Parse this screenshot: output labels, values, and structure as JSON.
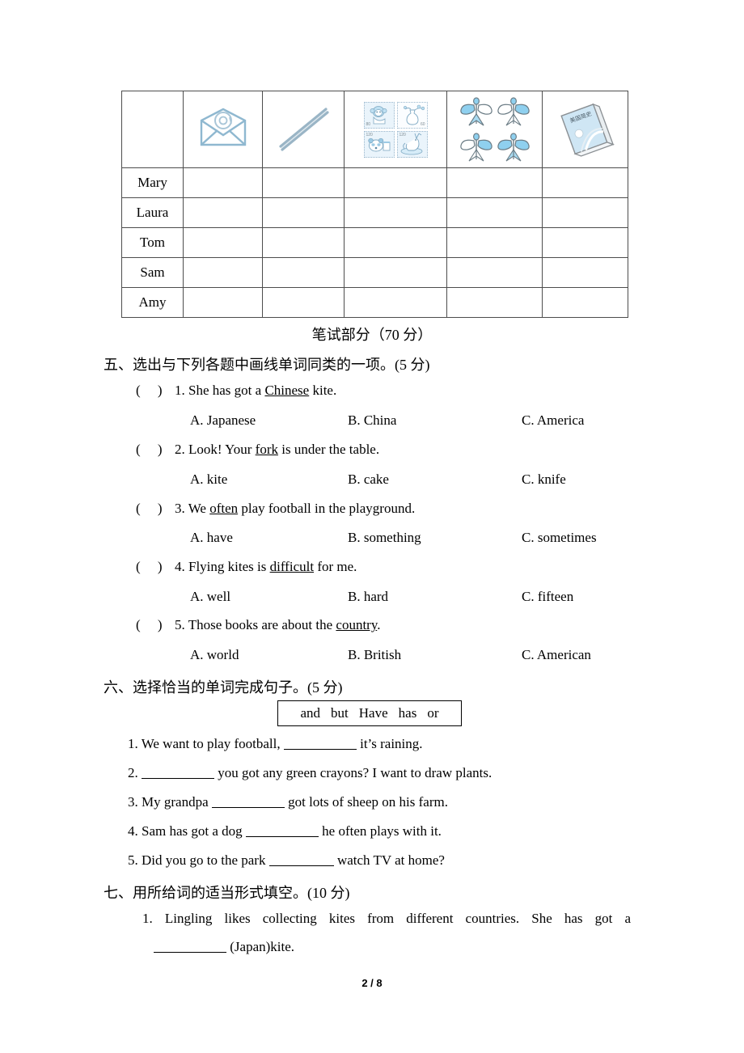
{
  "page": {
    "footer": "2 / 8",
    "written_part_heading": "笔试部分（70 分）"
  },
  "survey_table": {
    "columns": [
      {
        "icon": "email-envelope-icon",
        "label": "email"
      },
      {
        "icon": "chopsticks-icon",
        "label": "chopsticks"
      },
      {
        "icon": "stamps-icon",
        "label": "stamps"
      },
      {
        "icon": "swallow-kites-icon",
        "label": "kites"
      },
      {
        "icon": "book-icon",
        "label": "book",
        "book_title": "美国简史"
      }
    ],
    "stamps": [
      {
        "value": "80",
        "pos": "bl",
        "animal": "monkey"
      },
      {
        "value": "60",
        "pos": "br",
        "animal": "vase-flowers"
      },
      {
        "value": "120",
        "pos": "tl",
        "animal": "panda"
      },
      {
        "value": "120",
        "pos": "tl",
        "animal": "deer"
      }
    ],
    "rows": [
      {
        "name": "Mary"
      },
      {
        "name": "Laura"
      },
      {
        "name": "Tom"
      },
      {
        "name": "Sam"
      },
      {
        "name": "Amy"
      }
    ]
  },
  "section_five": {
    "heading": "五、选出与下列各题中画线单词同类的一项。(5 分)",
    "questions": [
      {
        "marker": "(",
        "close": ")",
        "number": "1.",
        "pre": " She has got a ",
        "underlined": "Chinese",
        "post": " kite.",
        "options": {
          "a": "A. Japanese",
          "b": "B. China",
          "c": "C. America"
        }
      },
      {
        "marker": "(",
        "close": ")",
        "number": "2.",
        "pre": " Look! Your ",
        "underlined": "fork",
        "post": " is under the table.",
        "options": {
          "a": "A. kite",
          "b": "B. cake",
          "c": "C. knife"
        }
      },
      {
        "marker": "(",
        "close": ")",
        "number": "3.",
        "pre": " We ",
        "underlined": "often",
        "post": " play football in the playground.",
        "options": {
          "a": "A. have",
          "b": "B. something",
          "c": "C. sometimes"
        }
      },
      {
        "marker": "(",
        "close": ")",
        "number": "4.",
        "pre": " Flying kites is ",
        "underlined": "difficult",
        "post": " for me.",
        "options": {
          "a": "A. well",
          "b": "B. hard",
          "c": "C. fifteen"
        }
      },
      {
        "marker": "(",
        "close": ")",
        "number": "5.",
        "pre": " Those books are about the ",
        "underlined": "country",
        "post": ".",
        "options": {
          "a": "A. world",
          "b": "B. British",
          "c": "C. American"
        }
      }
    ]
  },
  "section_six": {
    "heading": "六、选择恰当的单词完成句子。(5 分)",
    "word_bank": [
      "and",
      "but",
      "Have",
      "has",
      "or"
    ],
    "items": [
      {
        "number": "1.",
        "pre": " We want to play football, ",
        "post": " it’s raining."
      },
      {
        "number": "2.",
        "pre": " ",
        "post": " you got any green crayons? I want to draw plants."
      },
      {
        "number": "3.",
        "pre": " My grandpa ",
        "post": " got lots of sheep on his farm."
      },
      {
        "number": "4.",
        "pre": " Sam has got a dog ",
        "post": " he often plays with it."
      },
      {
        "number": "5.",
        "pre": " Did you go to the park ",
        "post": " watch TV at home?"
      }
    ]
  },
  "section_seven": {
    "heading": "七、用所给词的适当形式填空。(10 分)",
    "item1_line1": "1.  Lingling  likes  collecting  kites  from  different  countries.  She  has  got  a",
    "item1_line2_post": " (Japan)kite."
  }
}
